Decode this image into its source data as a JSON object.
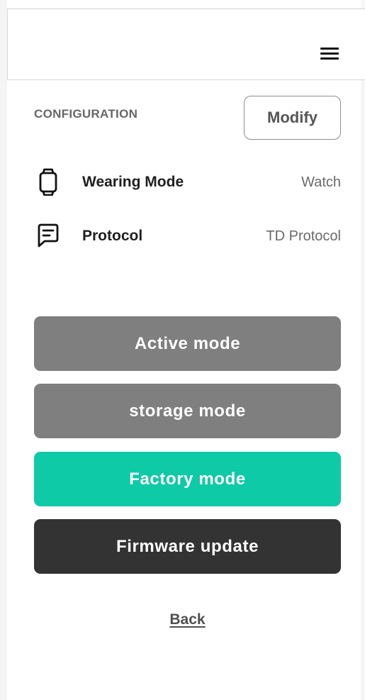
{
  "header": {
    "menu_icon": "hamburger-menu-icon"
  },
  "configuration": {
    "title": "CONFIGURATION",
    "modify_label": "Modify",
    "rows": [
      {
        "icon": "watch-icon",
        "label": "Wearing Mode",
        "value": "Watch"
      },
      {
        "icon": "message-icon",
        "label": "Protocol",
        "value": "TD Protocol"
      }
    ]
  },
  "actions": {
    "active_mode": "Active mode",
    "storage_mode": "storage mode",
    "factory_mode": "Factory mode",
    "firmware_update": "Firmware update"
  },
  "colors": {
    "grey_button": "#7f7f7f",
    "factory_button": "#0fcaa6",
    "firmware_button": "#333333"
  },
  "footer": {
    "back_label": "Back"
  }
}
